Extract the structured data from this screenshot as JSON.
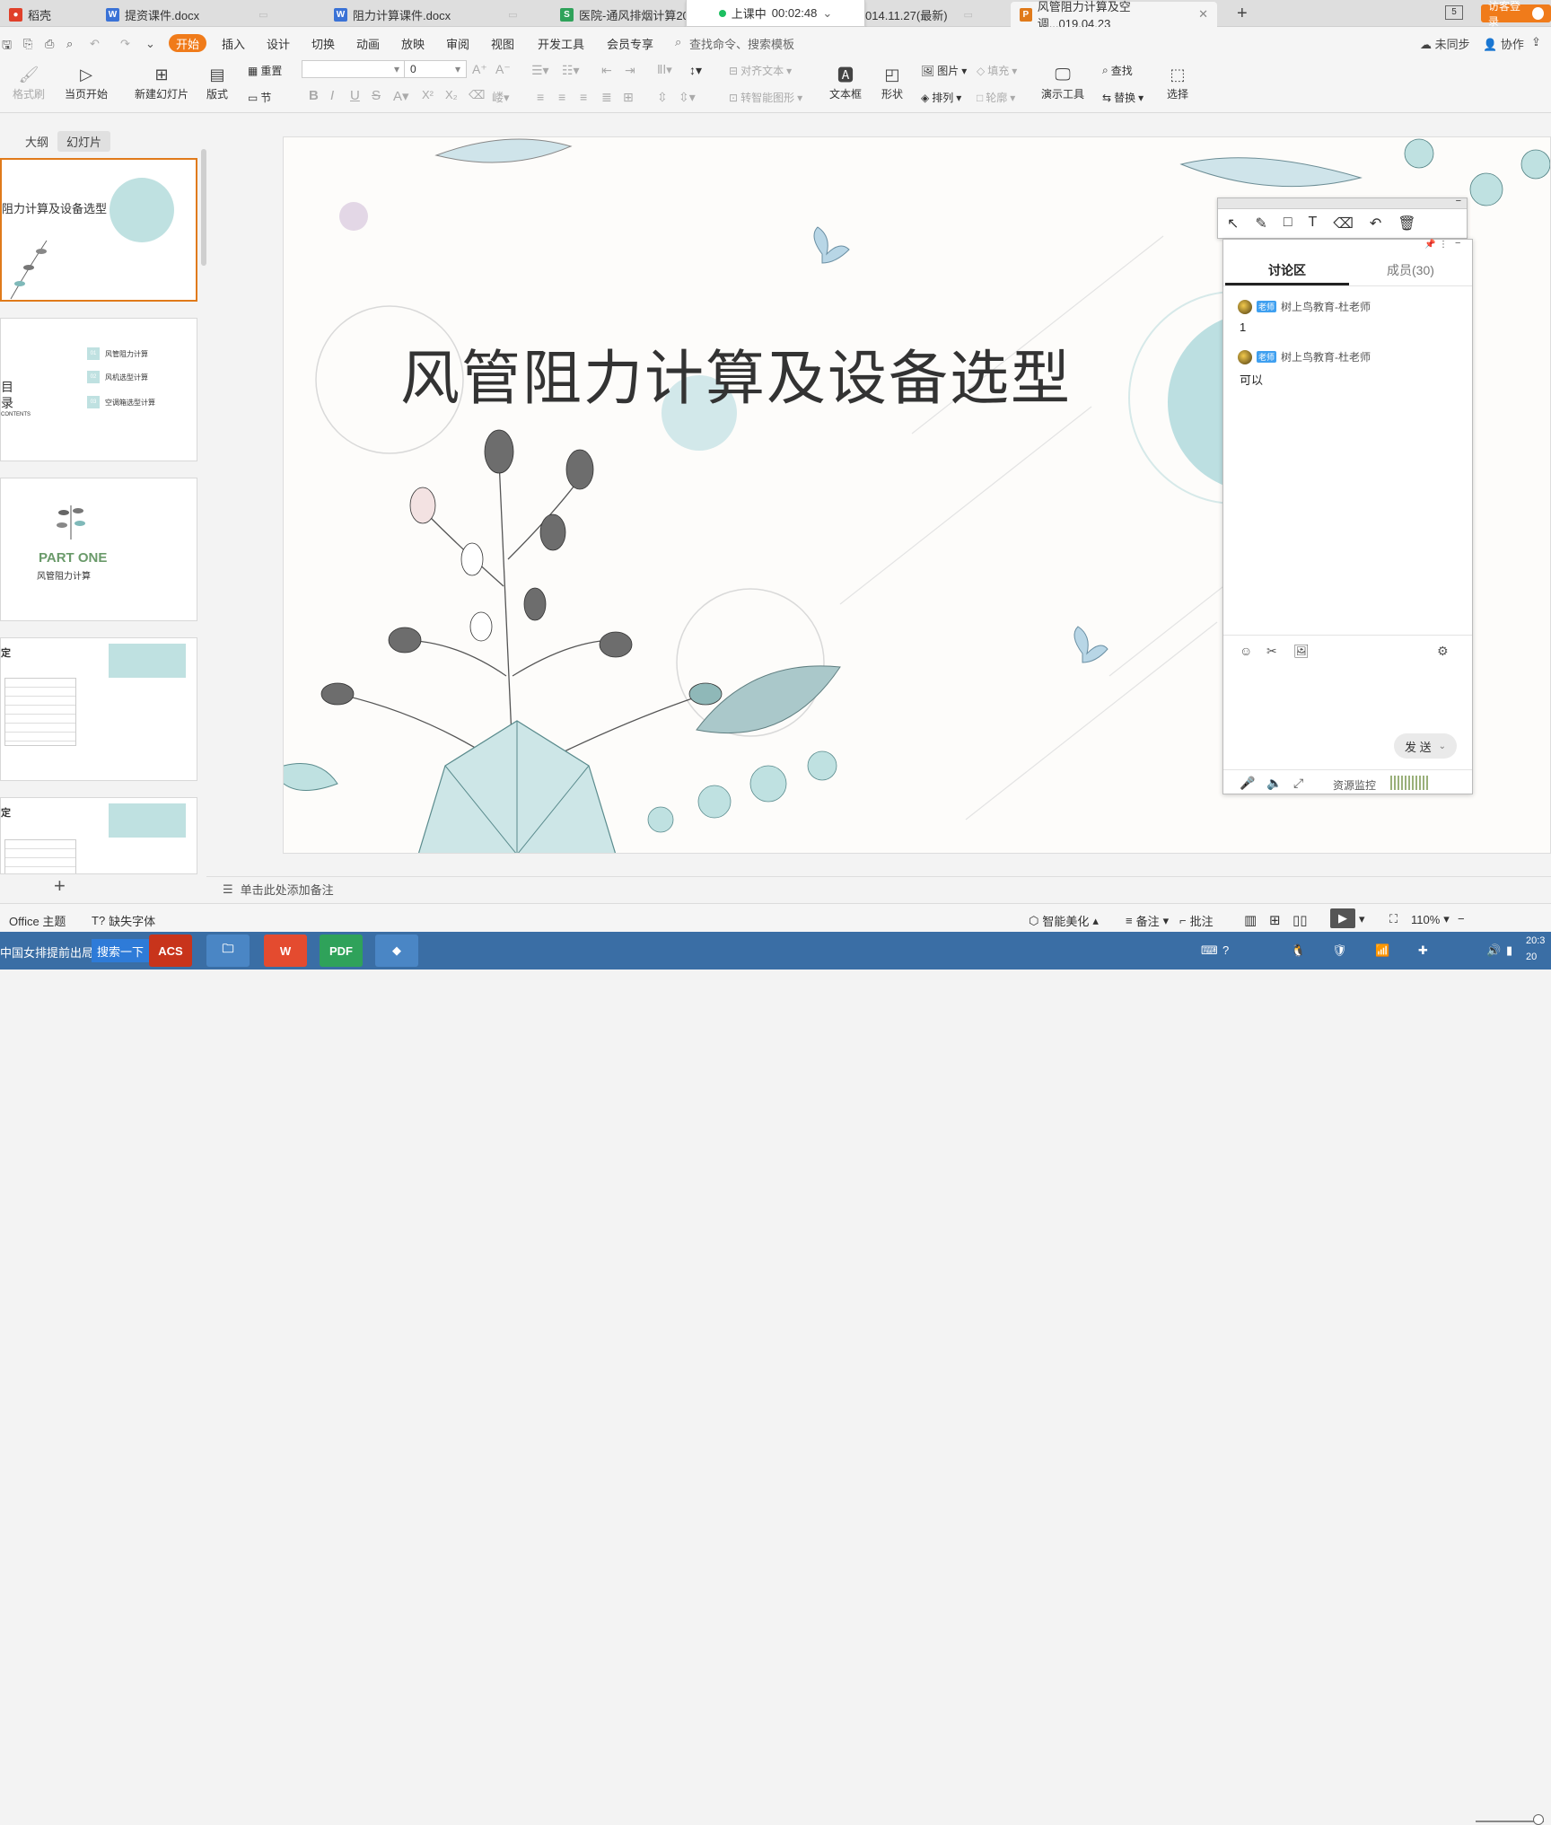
{
  "tabs": [
    {
      "label": "稻壳",
      "icon_color": "#e0402a"
    },
    {
      "label": "提资课件.docx",
      "icon_color": "#3a72d6"
    },
    {
      "label": "阻力计算课件.docx",
      "icon_color": "#3a72d6"
    },
    {
      "label": "医院-通风排烟计算201",
      "icon_color": "#2fa25a"
    },
    {
      "label": "014.11.27(最新)",
      "icon_color": "#2fa25a"
    },
    {
      "label": "风管阻力计算及空调...019.04.23",
      "icon_color": "#e07a1a"
    }
  ],
  "new_tab": "+",
  "tab_count": "5",
  "class_timer": {
    "status": "上课中",
    "time": "00:02:48"
  },
  "login_label": "访客登录",
  "menu": {
    "start": "开始",
    "items": [
      "插入",
      "设计",
      "切换",
      "动画",
      "放映",
      "审阅",
      "视图",
      "开发工具",
      "会员专享"
    ],
    "search_placeholder": "查找命令、搜索模板",
    "right": [
      "未同步",
      "协作"
    ]
  },
  "ribbon": {
    "format_painter": "格式刷",
    "play_from_current": "当页开始",
    "new_slide": "新建幻灯片",
    "layout": "版式",
    "reset": "重置",
    "section": "节",
    "font_size": "0",
    "align_text": "对齐文本",
    "smartart": "转智能图形",
    "textbox": "文本框",
    "shape": "形状",
    "picture": "图片",
    "arrange": "排列",
    "fill": "填充",
    "outline": "轮廓",
    "present_tools": "演示工具",
    "find": "查找",
    "replace": "替换",
    "select": "选择"
  },
  "panel_tabs": [
    "大纲",
    "幻灯片"
  ],
  "thumbs": [
    {
      "title": "阻力计算及设备选型"
    },
    {
      "heading1": "目",
      "heading2": "录",
      "en": "CONTENTS",
      "items": [
        {
          "num": "01",
          "text": "风管阻力计算"
        },
        {
          "num": "02",
          "text": "风机选型计算"
        },
        {
          "num": "03",
          "text": "空调箱选型计算"
        }
      ]
    },
    {
      "part": "PART ONE",
      "subtitle": "风管阻力计算"
    },
    {
      "heading": "定"
    },
    {
      "heading": "定"
    }
  ],
  "add_slide": "+",
  "slide": {
    "title": "风管阻力计算及设备选型"
  },
  "notes_placeholder": "单击此处添加备注",
  "status": {
    "theme": "Office 主题",
    "missing_font": "缺失字体",
    "beautify": "智能美化",
    "notes": "备注",
    "comments": "批注",
    "zoom": "110%"
  },
  "chat": {
    "tab_discussion": "讨论区",
    "tab_members": "成员(30)",
    "messages": [
      {
        "role": "老师",
        "sender": "树上鸟教育-杜老师",
        "text": "1"
      },
      {
        "role": "老师",
        "sender": "树上鸟教育-杜老师",
        "text": "可以"
      }
    ],
    "send": "发 送",
    "monitor": "资源监控"
  },
  "taskbar": {
    "news": "中国女排提前出局",
    "search": "搜索一下",
    "apps": [
      "ACS",
      "",
      "W",
      "PDF",
      ""
    ],
    "clock_top": "20:3",
    "clock_bottom": "20"
  }
}
